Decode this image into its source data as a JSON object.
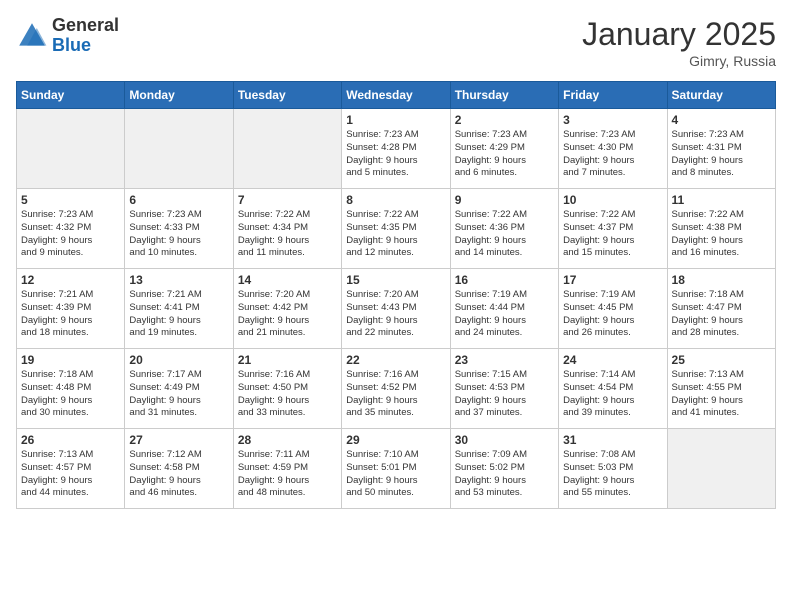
{
  "header": {
    "logo_general": "General",
    "logo_blue": "Blue",
    "month_title": "January 2025",
    "location": "Gimry, Russia"
  },
  "days_of_week": [
    "Sunday",
    "Monday",
    "Tuesday",
    "Wednesday",
    "Thursday",
    "Friday",
    "Saturday"
  ],
  "weeks": [
    [
      {
        "day": "",
        "info": "",
        "shaded": true
      },
      {
        "day": "",
        "info": "",
        "shaded": true
      },
      {
        "day": "",
        "info": "",
        "shaded": true
      },
      {
        "day": "1",
        "info": "Sunrise: 7:23 AM\nSunset: 4:28 PM\nDaylight: 9 hours\nand 5 minutes.",
        "shaded": false
      },
      {
        "day": "2",
        "info": "Sunrise: 7:23 AM\nSunset: 4:29 PM\nDaylight: 9 hours\nand 6 minutes.",
        "shaded": false
      },
      {
        "day": "3",
        "info": "Sunrise: 7:23 AM\nSunset: 4:30 PM\nDaylight: 9 hours\nand 7 minutes.",
        "shaded": false
      },
      {
        "day": "4",
        "info": "Sunrise: 7:23 AM\nSunset: 4:31 PM\nDaylight: 9 hours\nand 8 minutes.",
        "shaded": false
      }
    ],
    [
      {
        "day": "5",
        "info": "Sunrise: 7:23 AM\nSunset: 4:32 PM\nDaylight: 9 hours\nand 9 minutes.",
        "shaded": false
      },
      {
        "day": "6",
        "info": "Sunrise: 7:23 AM\nSunset: 4:33 PM\nDaylight: 9 hours\nand 10 minutes.",
        "shaded": false
      },
      {
        "day": "7",
        "info": "Sunrise: 7:22 AM\nSunset: 4:34 PM\nDaylight: 9 hours\nand 11 minutes.",
        "shaded": false
      },
      {
        "day": "8",
        "info": "Sunrise: 7:22 AM\nSunset: 4:35 PM\nDaylight: 9 hours\nand 12 minutes.",
        "shaded": false
      },
      {
        "day": "9",
        "info": "Sunrise: 7:22 AM\nSunset: 4:36 PM\nDaylight: 9 hours\nand 14 minutes.",
        "shaded": false
      },
      {
        "day": "10",
        "info": "Sunrise: 7:22 AM\nSunset: 4:37 PM\nDaylight: 9 hours\nand 15 minutes.",
        "shaded": false
      },
      {
        "day": "11",
        "info": "Sunrise: 7:22 AM\nSunset: 4:38 PM\nDaylight: 9 hours\nand 16 minutes.",
        "shaded": false
      }
    ],
    [
      {
        "day": "12",
        "info": "Sunrise: 7:21 AM\nSunset: 4:39 PM\nDaylight: 9 hours\nand 18 minutes.",
        "shaded": false
      },
      {
        "day": "13",
        "info": "Sunrise: 7:21 AM\nSunset: 4:41 PM\nDaylight: 9 hours\nand 19 minutes.",
        "shaded": false
      },
      {
        "day": "14",
        "info": "Sunrise: 7:20 AM\nSunset: 4:42 PM\nDaylight: 9 hours\nand 21 minutes.",
        "shaded": false
      },
      {
        "day": "15",
        "info": "Sunrise: 7:20 AM\nSunset: 4:43 PM\nDaylight: 9 hours\nand 22 minutes.",
        "shaded": false
      },
      {
        "day": "16",
        "info": "Sunrise: 7:19 AM\nSunset: 4:44 PM\nDaylight: 9 hours\nand 24 minutes.",
        "shaded": false
      },
      {
        "day": "17",
        "info": "Sunrise: 7:19 AM\nSunset: 4:45 PM\nDaylight: 9 hours\nand 26 minutes.",
        "shaded": false
      },
      {
        "day": "18",
        "info": "Sunrise: 7:18 AM\nSunset: 4:47 PM\nDaylight: 9 hours\nand 28 minutes.",
        "shaded": false
      }
    ],
    [
      {
        "day": "19",
        "info": "Sunrise: 7:18 AM\nSunset: 4:48 PM\nDaylight: 9 hours\nand 30 minutes.",
        "shaded": false
      },
      {
        "day": "20",
        "info": "Sunrise: 7:17 AM\nSunset: 4:49 PM\nDaylight: 9 hours\nand 31 minutes.",
        "shaded": false
      },
      {
        "day": "21",
        "info": "Sunrise: 7:16 AM\nSunset: 4:50 PM\nDaylight: 9 hours\nand 33 minutes.",
        "shaded": false
      },
      {
        "day": "22",
        "info": "Sunrise: 7:16 AM\nSunset: 4:52 PM\nDaylight: 9 hours\nand 35 minutes.",
        "shaded": false
      },
      {
        "day": "23",
        "info": "Sunrise: 7:15 AM\nSunset: 4:53 PM\nDaylight: 9 hours\nand 37 minutes.",
        "shaded": false
      },
      {
        "day": "24",
        "info": "Sunrise: 7:14 AM\nSunset: 4:54 PM\nDaylight: 9 hours\nand 39 minutes.",
        "shaded": false
      },
      {
        "day": "25",
        "info": "Sunrise: 7:13 AM\nSunset: 4:55 PM\nDaylight: 9 hours\nand 41 minutes.",
        "shaded": false
      }
    ],
    [
      {
        "day": "26",
        "info": "Sunrise: 7:13 AM\nSunset: 4:57 PM\nDaylight: 9 hours\nand 44 minutes.",
        "shaded": false
      },
      {
        "day": "27",
        "info": "Sunrise: 7:12 AM\nSunset: 4:58 PM\nDaylight: 9 hours\nand 46 minutes.",
        "shaded": false
      },
      {
        "day": "28",
        "info": "Sunrise: 7:11 AM\nSunset: 4:59 PM\nDaylight: 9 hours\nand 48 minutes.",
        "shaded": false
      },
      {
        "day": "29",
        "info": "Sunrise: 7:10 AM\nSunset: 5:01 PM\nDaylight: 9 hours\nand 50 minutes.",
        "shaded": false
      },
      {
        "day": "30",
        "info": "Sunrise: 7:09 AM\nSunset: 5:02 PM\nDaylight: 9 hours\nand 53 minutes.",
        "shaded": false
      },
      {
        "day": "31",
        "info": "Sunrise: 7:08 AM\nSunset: 5:03 PM\nDaylight: 9 hours\nand 55 minutes.",
        "shaded": false
      },
      {
        "day": "",
        "info": "",
        "shaded": true
      }
    ]
  ]
}
